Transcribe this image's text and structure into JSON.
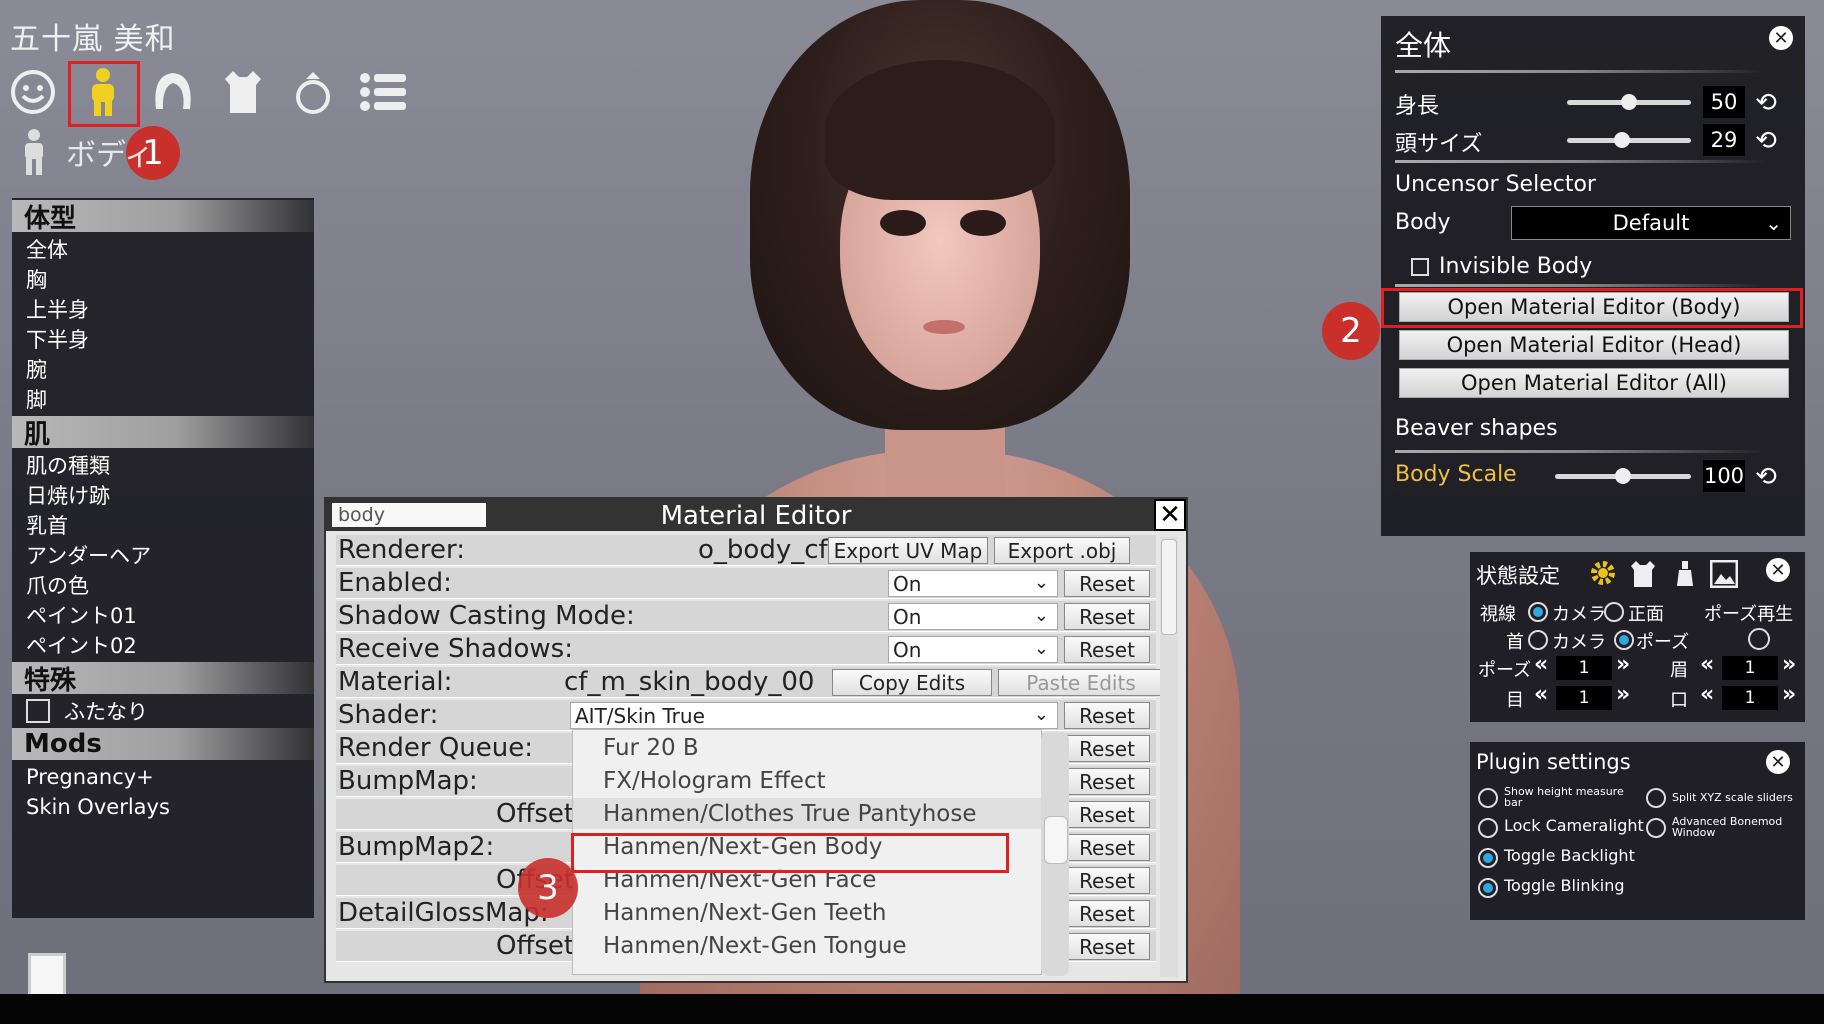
{
  "character_name": "五十嵐 美和",
  "top_icons": [
    "face-icon",
    "body-icon",
    "hair-icon",
    "clothes-icon",
    "accessory-icon",
    "list-icon"
  ],
  "section_title": "ボディ",
  "annotations": {
    "badge1": "1",
    "badge2": "2",
    "badge3": "3"
  },
  "left_menu": {
    "cat1": "体型",
    "cat1_items": [
      "全体",
      "胸",
      "上半身",
      "下半身",
      "腕",
      "脚"
    ],
    "cat2": "肌",
    "cat2_items": [
      "肌の種類",
      "日焼け跡",
      "乳首",
      "アンダーヘア",
      "爪の色",
      "ペイント01",
      "ペイント02"
    ],
    "cat3": "特殊",
    "cat3_items": [
      "ふたなり"
    ],
    "cat4": "Mods",
    "cat4_items": [
      "Pregnancy+",
      "Skin Overlays"
    ]
  },
  "right_panel": {
    "title": "全体",
    "height_label": "身長",
    "height_value": "50",
    "height_level": 0.5,
    "head_label": "頭サイズ",
    "head_value": "29",
    "head_level": 0.44,
    "uncensor_label": "Uncensor Selector",
    "body_label": "Body",
    "body_dropdown": "Default",
    "invisible_body": "Invisible Body",
    "btn_body": "Open Material Editor (Body)",
    "btn_head": "Open Material Editor (Head)",
    "btn_all": "Open Material Editor (All)",
    "beaver_label": "Beaver shapes",
    "body_scale_label": "Body Scale",
    "body_scale_value": "100",
    "body_scale_level": 0.5,
    "body_scale_color": "#f0c040"
  },
  "status_panel": {
    "title": "状態設定",
    "gaze_label": "視線",
    "gaze_opt1": "カメラ",
    "gaze_opt2": "正面",
    "pose_play": "ポーズ再生",
    "neck_label": "首",
    "neck_opt1": "カメラ",
    "neck_opt2": "ポーズ",
    "pose_label": "ポーズ",
    "pose_value": "1",
    "brow_label": "眉",
    "brow_value": "1",
    "eye_label": "目",
    "eye_value": "1",
    "mouth_label": "口",
    "mouth_value": "1"
  },
  "plugin_panel": {
    "title": "Plugin settings",
    "opt_height_bar": "Show height measure bar",
    "opt_split_xyz": "Split XYZ scale sliders",
    "opt_lock_camera": "Lock Cameralight",
    "opt_bonemod": "Advanced Bonemod Window",
    "opt_backlight": "Toggle Backlight",
    "opt_blinking": "Toggle Blinking"
  },
  "material_editor": {
    "title": "Material Editor",
    "search_value": "body",
    "renderer_label": "Renderer:",
    "renderer_value": "o_body_cf",
    "export_uv": "Export UV Map",
    "export_obj": "Export .obj",
    "enabled_label": "Enabled:",
    "enabled_value": "On",
    "shadow_cast_label": "Shadow Casting Mode:",
    "shadow_cast_value": "On",
    "receive_label": "Receive Shadows:",
    "receive_value": "On",
    "material_label": "Material:",
    "material_value": "cf_m_skin_body_00",
    "copy_edits": "Copy Edits",
    "paste_edits": "Paste Edits",
    "shader_label": "Shader:",
    "shader_value": "AIT/Skin True",
    "render_queue_label": "Render Queue:",
    "bumpmap_label": "BumpMap:",
    "offset_label": "Offset",
    "bumpmap2_label": "BumpMap2:",
    "detailgloss_label": "DetailGlossMap:",
    "reset": "Reset",
    "shader_options": [
      "Fur 20 B",
      "FX/Hologram Effect",
      "Hanmen/Clothes True Pantyhose",
      "Hanmen/Next-Gen Body",
      "Hanmen/Next-Gen Face",
      "Hanmen/Next-Gen Teeth",
      "Hanmen/Next-Gen Tongue"
    ]
  },
  "colors": {
    "highlight_red": "#e02020",
    "badge_red": "#c9302c",
    "radio_blue": "#2fa8e0",
    "icon_yellow": "#f0d020"
  }
}
